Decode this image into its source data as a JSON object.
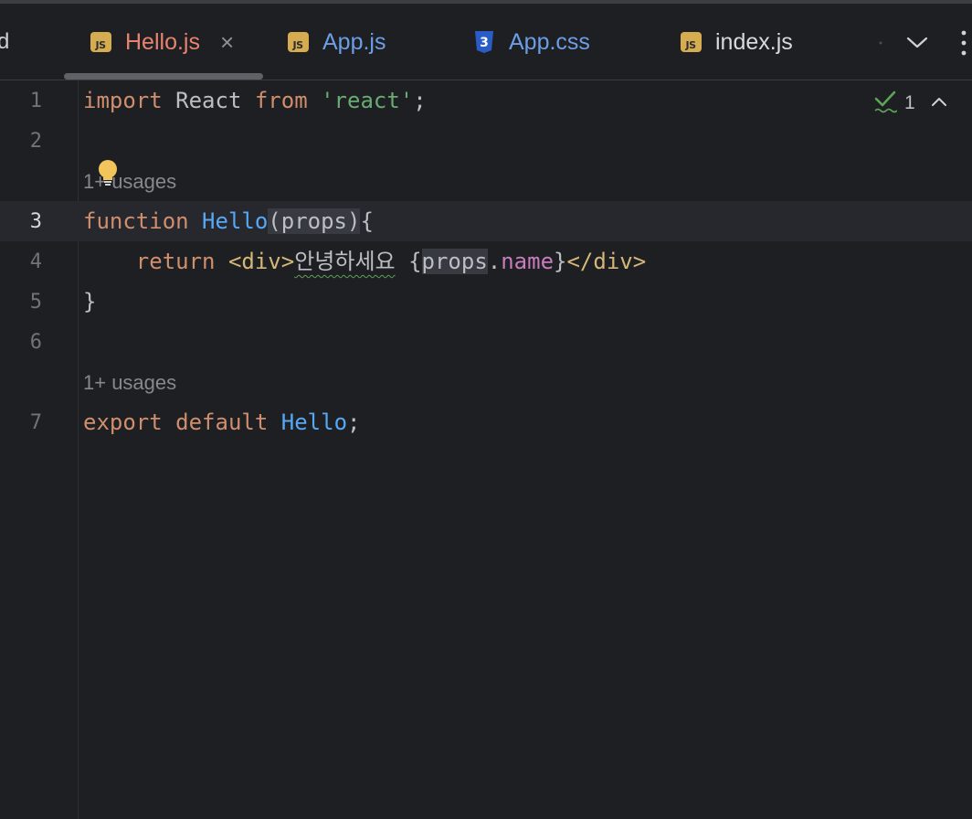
{
  "tabs": [
    {
      "label": "Hello.js",
      "icon": "js-file-icon",
      "badge": "JS",
      "active": true,
      "color": "#e8836f"
    },
    {
      "label": "App.js",
      "icon": "js-file-icon",
      "badge": "JS",
      "active": false,
      "color": "#6c9ee6"
    },
    {
      "label": "App.css",
      "icon": "css-file-icon",
      "badge": "3",
      "active": false,
      "color": "#6c9ee6"
    },
    {
      "label": "index.js",
      "icon": "js-file-icon",
      "badge": "JS",
      "active": false,
      "color": "#d7d9dd"
    }
  ],
  "tab_fragment": "d",
  "tab_controls": {
    "more_tabs_icon": "chevron-down-icon",
    "menu_icon": "more-vertical-icon"
  },
  "inspection": {
    "icon": "check-icon",
    "count": "1",
    "prev_icon": "chevron-up-icon"
  },
  "editor": {
    "line_numbers": [
      "1",
      "2",
      "3",
      "4",
      "5",
      "6",
      "7"
    ],
    "current_line": "3",
    "usage_hints": [
      "1+ usages",
      "1+ usages"
    ],
    "line1": {
      "kw_import": "import",
      "name": " React ",
      "kw_from": "from",
      "space": " ",
      "str": "'react'",
      "semi": ";"
    },
    "line3": {
      "kw_function": "function",
      "space": " ",
      "fn_name": "Hello",
      "paren_open": "(",
      "param": "props",
      "paren_close": ")",
      "brace": "{"
    },
    "line4": {
      "indent": "    ",
      "kw_return": "return",
      "space": " ",
      "open_tag": "<div>",
      "korean": "안녕하세요",
      "space2": " ",
      "brace_open": "{",
      "obj": "props",
      "dot": ".",
      "prop": "name",
      "brace_close": "}",
      "close_tag": "</div>"
    },
    "line5": {
      "brace": "}"
    },
    "line7": {
      "kw_export": "export",
      "space": " ",
      "kw_default": "default",
      "space2": " ",
      "fn_name": "Hello",
      "semi": ";"
    }
  },
  "colors": {
    "background": "#1e1f22",
    "keyword": "#cf8e6d",
    "string": "#6aab73",
    "function": "#56a8f5",
    "tag": "#d5b778",
    "field": "#c77dbb",
    "js_badge": "#d6ac51",
    "css_badge": "#2a5cc8"
  }
}
